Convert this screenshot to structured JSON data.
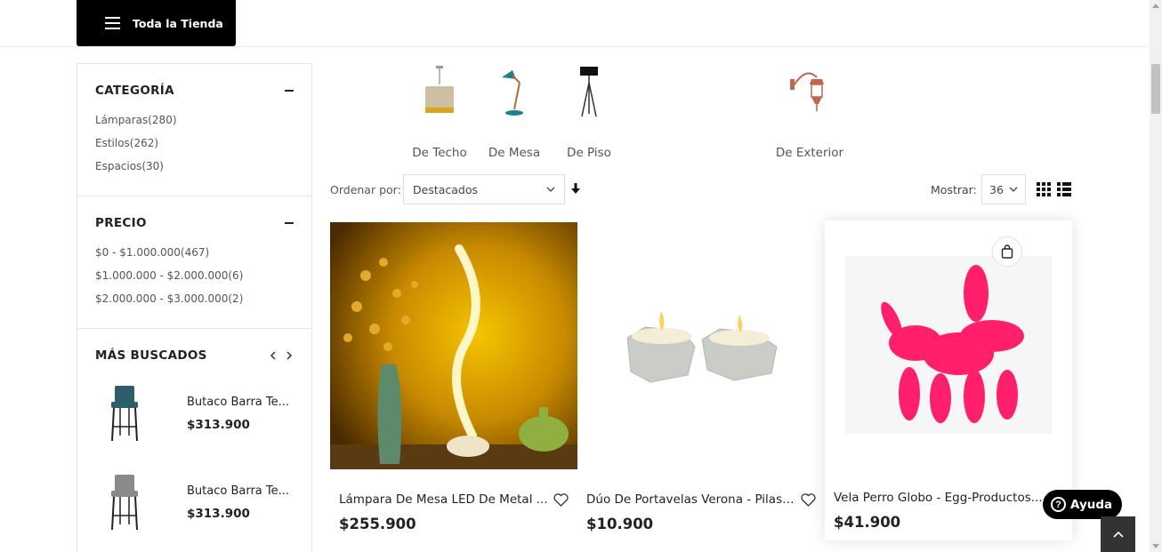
{
  "header": {
    "store_button_label": "Toda la Tienda"
  },
  "sidebar": {
    "category": {
      "title": "CATEGORÍA",
      "items": [
        "Lámparas(280)",
        "Estilos(262)",
        "Espacios(30)"
      ]
    },
    "price": {
      "title": "PRECIO",
      "items": [
        "$0 - $1.000.000(467)",
        "$1.000.000 - $2.000.000(6)",
        "$2.000.000 - $3.000.000(2)"
      ]
    },
    "most_searched": {
      "title": "MÁS BUSCADOS",
      "products": [
        {
          "name": "Butaco Barra Te...",
          "price": "$313.900",
          "color": "#2e5d6b"
        },
        {
          "name": "Butaco Barra Te...",
          "price": "$313.900",
          "color": "#8a8a8a"
        }
      ]
    }
  },
  "categories_strip": [
    {
      "label": "De Techo",
      "icon": "ceiling-lamp-icon"
    },
    {
      "label": "De Mesa",
      "icon": "desk-lamp-icon"
    },
    {
      "label": "De Piso",
      "icon": "floor-lamp-icon"
    },
    {
      "label": "De Exterior",
      "icon": "outdoor-lamp-icon"
    }
  ],
  "toolbar": {
    "sort_label": "Ordenar por:",
    "sort_value": "Destacados",
    "show_label": "Mostrar:",
    "show_value": "36"
  },
  "products": [
    {
      "name": "Lámpara De Mesa LED De Metal ...",
      "price": "$255.900"
    },
    {
      "name": "Dúo De Portavelas Verona - Pilastro",
      "price": "$10.900"
    },
    {
      "name": "Vela Perro Globo - Egg-Productos...",
      "price": "$41.900"
    }
  ],
  "help": {
    "label": "Ayuda",
    "glyph": "?"
  },
  "colors": {
    "accent": "#000000",
    "balloon_dog": "#ff1f6a",
    "lamp_glow": "#f3b200"
  }
}
